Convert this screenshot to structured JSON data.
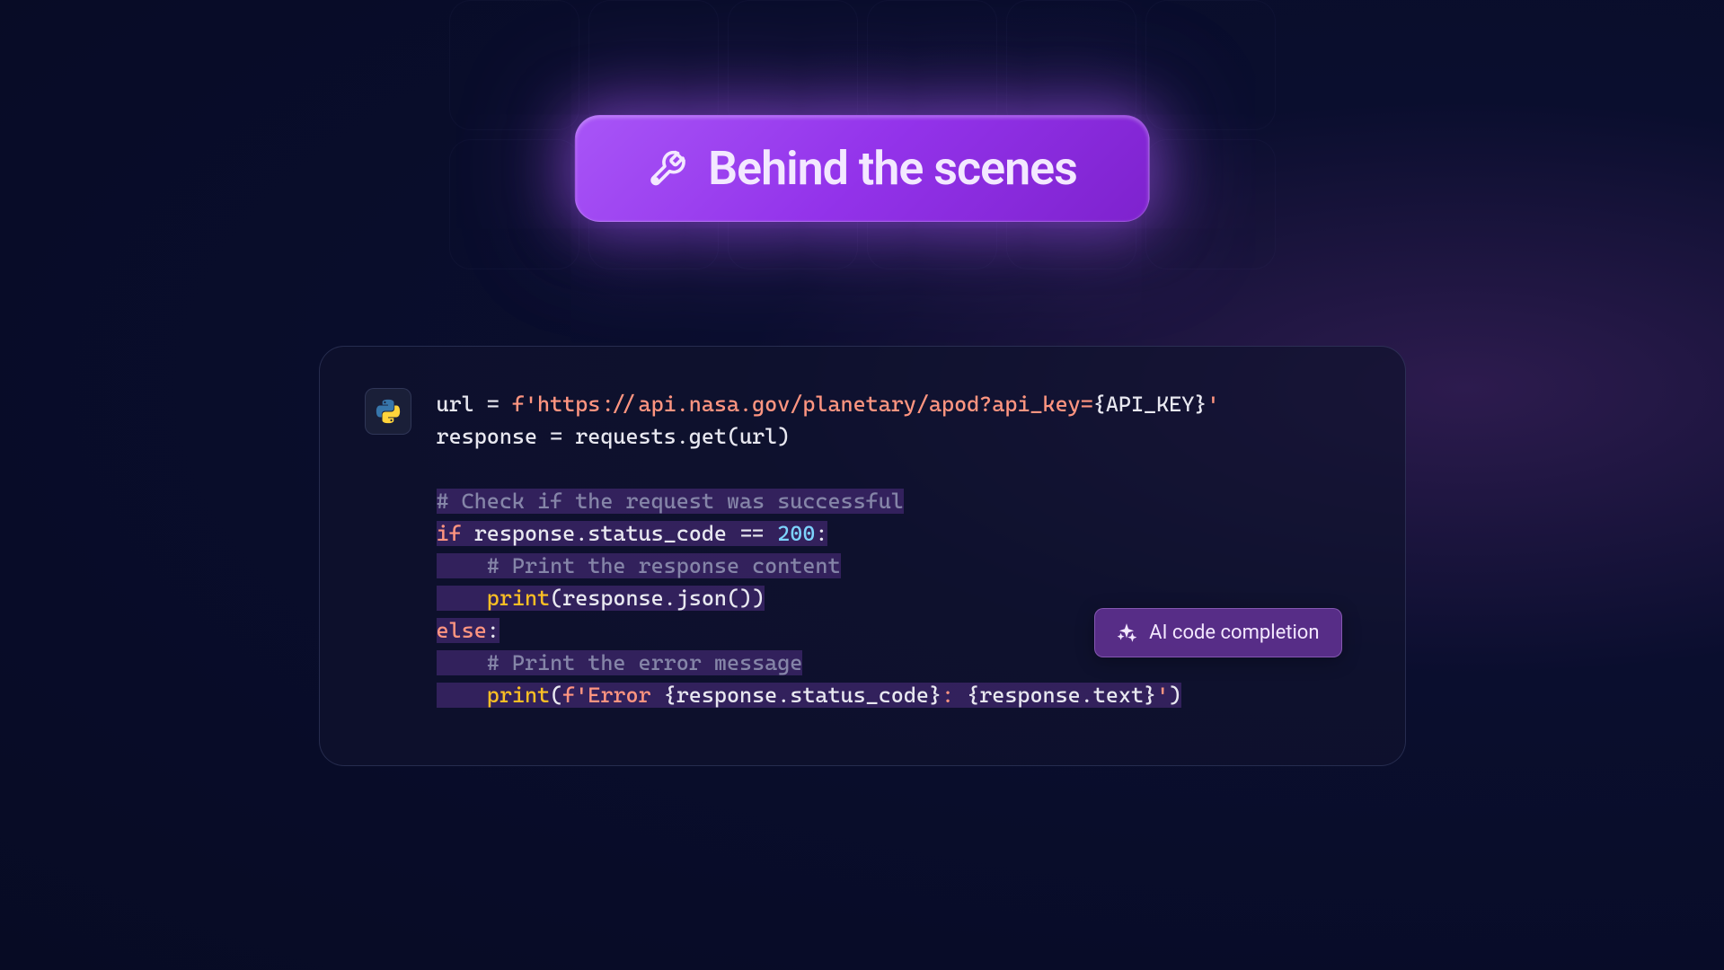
{
  "banner": {
    "title": "Behind the scenes",
    "icon_name": "tools-wrench-screwdriver"
  },
  "code_panel": {
    "language": "python",
    "language_icon": "python-logo",
    "lines": {
      "l1_var": "url",
      "l1_eq": " = ",
      "l1_fprefix": "f'",
      "l1_url": "https://api.nasa.gov/planetary/apod?api_key=",
      "l1_interp_open": "{",
      "l1_interp_var": "API_KEY",
      "l1_interp_close": "}",
      "l1_strend": "'",
      "l2": "response = requests.get(url)",
      "l3": "",
      "l4_comment": "# Check if the request was successful",
      "l5_if": "if",
      "l5_cond": " response.status_code == ",
      "l5_num": "200",
      "l5_colon": ":",
      "l6_comment": "    # Print the response content",
      "l7_indent": "    ",
      "l7_func": "print",
      "l7_args": "(response.json())",
      "l8_else": "else",
      "l8_colon": ":",
      "l9_comment": "    # Print the error message",
      "l10_indent": "    ",
      "l10_func": "print",
      "l10_open": "(",
      "l10_fprefix": "f'",
      "l10_str1": "Error ",
      "l10_i1o": "{",
      "l10_i1v": "response.status_code",
      "l10_i1c": "}",
      "l10_str2": ": ",
      "l10_i2o": "{",
      "l10_i2v": "response.text",
      "l10_i2c": "}",
      "l10_strend": "'",
      "l10_close": ")"
    }
  },
  "ai_tooltip": {
    "label": "AI code completion",
    "icon_name": "sparkles"
  },
  "colors": {
    "accent_purple": "#a855f7",
    "bg_dark": "#0a0e2e",
    "code_string": "#ff9580",
    "code_function": "#fbbf24",
    "code_number": "#7dd3fc",
    "code_comment": "#8585a8",
    "highlight_bg": "rgba(88, 50, 140, 0.5)"
  }
}
